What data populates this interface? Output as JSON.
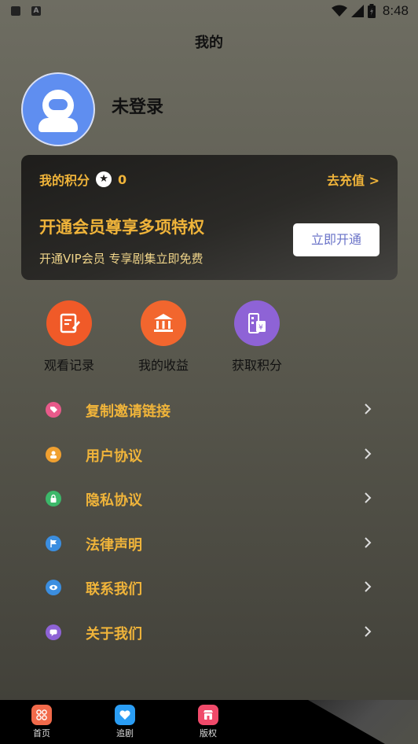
{
  "status_bar": {
    "time": "8:48"
  },
  "page_title": "我的",
  "profile": {
    "login_status": "未登录"
  },
  "vip_card": {
    "points_label": "我的积分",
    "points_value": "0",
    "recharge_link": "去充值 >",
    "title": "开通会员尊享多项特权",
    "subtitle": "开通VIP会员 专享剧集立即免费",
    "button": "立即开通"
  },
  "quick_actions": [
    {
      "label": "观看记录",
      "icon": "note-edit-icon",
      "color": "#f05a28"
    },
    {
      "label": "我的收益",
      "icon": "bank-icon",
      "color": "#f2662e"
    },
    {
      "label": "获取积分",
      "icon": "points-ticket-icon",
      "color": "#8e63d6"
    }
  ],
  "menu": [
    {
      "label": "复制邀请链接",
      "icon": "link-tag-icon",
      "color": "#e85a8a"
    },
    {
      "label": "用户协议",
      "icon": "user-agreement-icon",
      "color": "#f0a030"
    },
    {
      "label": "隐私协议",
      "icon": "privacy-lock-icon",
      "color": "#3cb86a"
    },
    {
      "label": "法律声明",
      "icon": "flag-icon",
      "color": "#3b8ee0"
    },
    {
      "label": "联系我们",
      "icon": "contact-eye-icon",
      "color": "#3b8ee0"
    },
    {
      "label": "关于我们",
      "icon": "about-chat-icon",
      "color": "#8e63d6"
    }
  ],
  "tabbar": [
    {
      "label": "首页",
      "icon": "home-grid-icon",
      "color": "#f26a4a"
    },
    {
      "label": "追剧",
      "icon": "heart-icon",
      "color": "#2a9df4"
    },
    {
      "label": "版权",
      "icon": "store-icon",
      "color": "#f04a6a"
    }
  ]
}
